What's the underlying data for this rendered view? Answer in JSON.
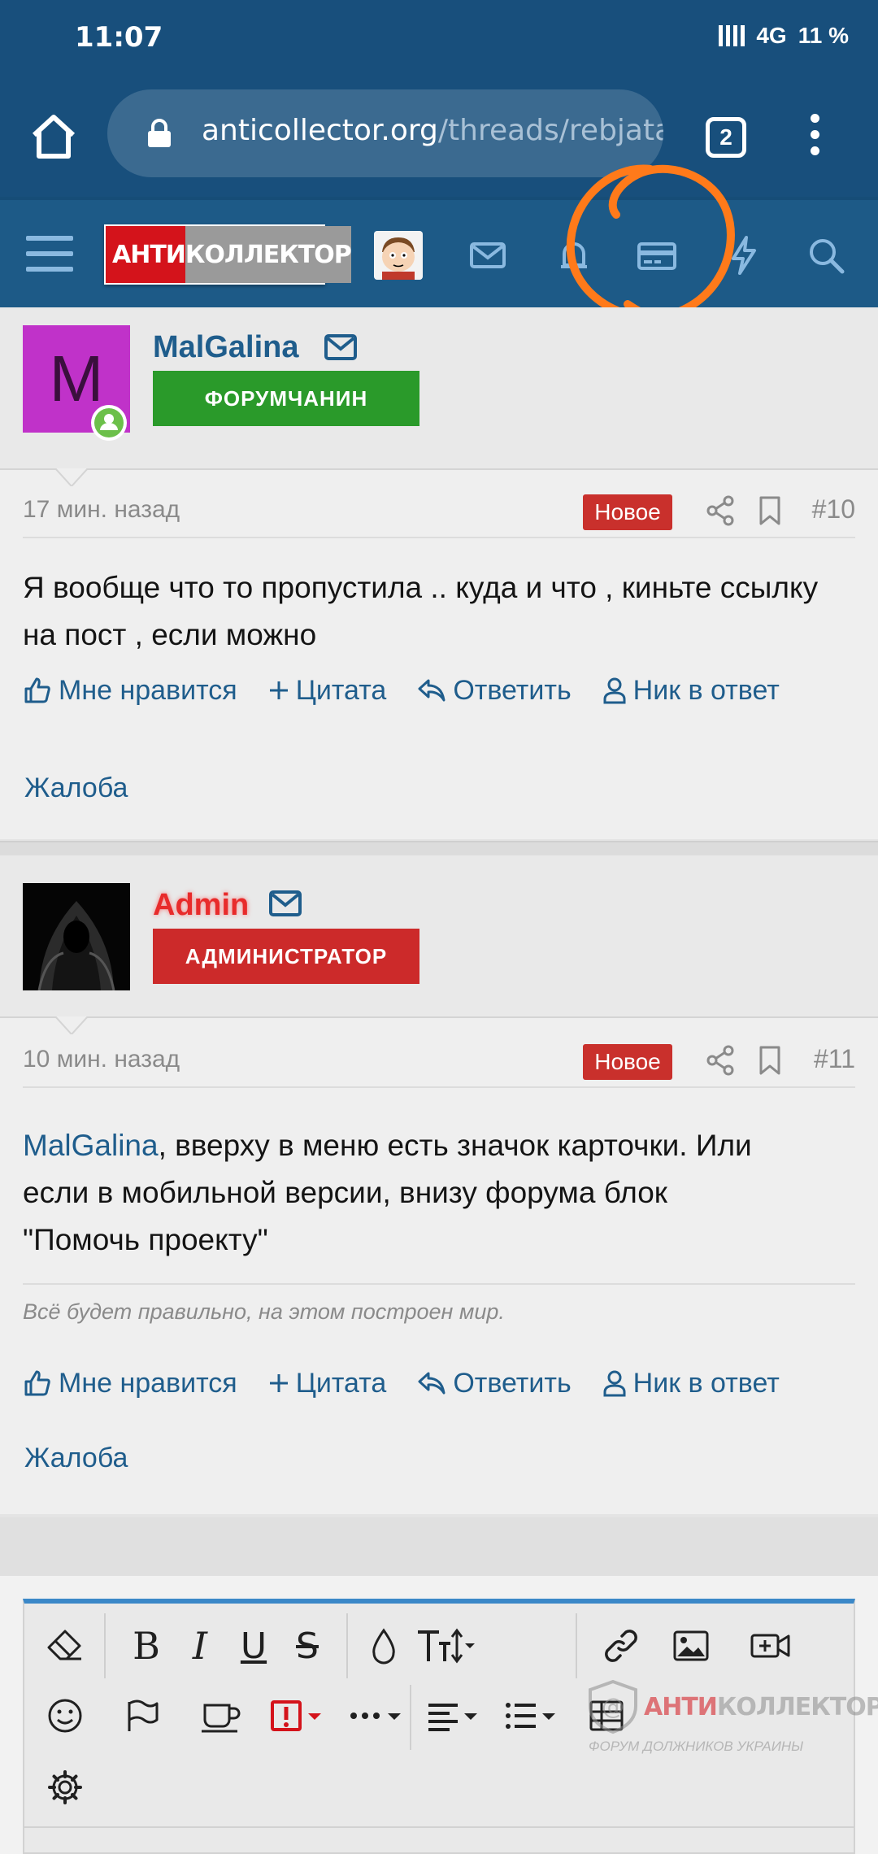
{
  "status_bar": {
    "time": "11:07",
    "network": "4G",
    "battery": "11 %"
  },
  "browser": {
    "url_host": "anticollector.org",
    "url_path": "/threads/rebjata",
    "tab_count": "2"
  },
  "site_nav": {
    "logo_red": "АНТИ",
    "logo_grey": "КОЛЛЕКТОР",
    "icons": [
      "menu-icon",
      "avatar",
      "mail-icon",
      "bell-icon",
      "card-icon",
      "lightning-icon",
      "search-icon"
    ]
  },
  "posts": [
    {
      "author": "MalGalina",
      "author_color": "#1f5d8c",
      "avatar_letter": "M",
      "avatar_bg": "#c032c9",
      "role": "ФОРУМЧАНИН",
      "role_color": "#2a9a2a",
      "time": "17 мин. назад",
      "badge": "Новое",
      "number": "#10",
      "text": "Я вообще что то пропустила .. куда и что , киньте ссылку на пост , если можно",
      "actions": [
        "Мне нравится",
        "Цитата",
        "Ответить",
        "Ник в ответ"
      ],
      "report": "Жалоба"
    },
    {
      "author": "Admin",
      "author_color": "#e82b2b",
      "role": "АДМИНИСТРАТОР",
      "role_color": "#cc2a2a",
      "time": "10 мин. назад",
      "badge": "Новое",
      "number": "#11",
      "mention": "MalGalina",
      "text_line1": ", вверху в меню есть значок карточки. Или",
      "text_line2": "если в мобильной версии, внизу форума блок",
      "text_line3": "\"Помочь проекту\"",
      "signature": "Всё будет правильно, на этом построен мир.",
      "actions": [
        "Мне нравится",
        "Цитата",
        "Ответить",
        "Ник в ответ"
      ],
      "report": "Жалоба"
    }
  ],
  "editor": {
    "toolbar_row1": [
      "eraser-icon",
      "B",
      "I",
      "U",
      "S",
      "color-drop-icon",
      "text-size-icon",
      "link-icon",
      "image-icon",
      "video-icon"
    ],
    "toolbar_row2": [
      "smiley-icon",
      "flag-icon",
      "cup-icon",
      "alert-icon",
      "more-icon",
      "align-icon",
      "list-icon",
      "table-icon"
    ],
    "toolbar_row3": [
      "gear-icon"
    ],
    "bold_label": "B",
    "italic_label": "I",
    "underline_label": "U",
    "strike_label": "S"
  },
  "watermark": {
    "red": "АНТИ",
    "grey": "КОЛЛЕКТОР",
    "subtitle": "ФОРУМ ДОЛЖНИКОВ УКРАИНЫ"
  },
  "colors": {
    "header_blue": "#184f7c",
    "nav_blue": "#1d5a87",
    "link_blue": "#1f5d8c",
    "new_badge": "#c9302c",
    "annotation_orange": "#ff7a1a"
  }
}
